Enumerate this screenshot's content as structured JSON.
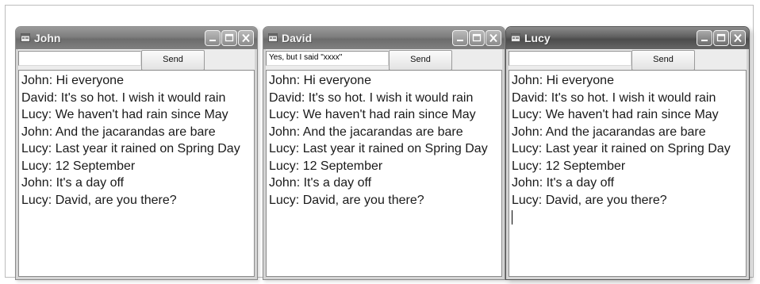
{
  "windows": [
    {
      "title": "John",
      "active": false,
      "input_value": "",
      "send_label": "Send",
      "messages": [
        "John: Hi everyone",
        "David: It's so hot. I wish it would rain",
        "Lucy: We haven't had rain since May",
        "John: And the jacarandas are bare",
        "Lucy: Last year it rained on Spring Day",
        "Lucy: 12 September",
        "John: It's a day off",
        "Lucy: David, are you there?"
      ]
    },
    {
      "title": "David",
      "active": false,
      "input_value": "Yes, but I said \"xxxx\"",
      "send_label": "Send",
      "messages": [
        "John: Hi everyone",
        "David: It's so hot. I wish it would rain",
        "Lucy: We haven't had rain since May",
        "John: And the jacarandas are bare",
        "Lucy: Last year it rained on Spring Day",
        "Lucy: 12 September",
        "John: It's a day off",
        "Lucy: David, are you there?"
      ]
    },
    {
      "title": "Lucy",
      "active": true,
      "input_value": "",
      "send_label": "Send",
      "messages": [
        "John: Hi everyone",
        "David: It's so hot. I wish it would rain",
        "Lucy: We haven't had rain since May",
        "John: And the jacarandas are bare",
        "Lucy: Last year it rained on Spring Day",
        "Lucy: 12 September",
        "John: It's a day off",
        "Lucy: David, are you there?"
      ]
    }
  ],
  "icons": {
    "app": "window-app-icon",
    "minimize": "minimize-icon",
    "maximize": "maximize-icon",
    "close": "close-icon"
  }
}
